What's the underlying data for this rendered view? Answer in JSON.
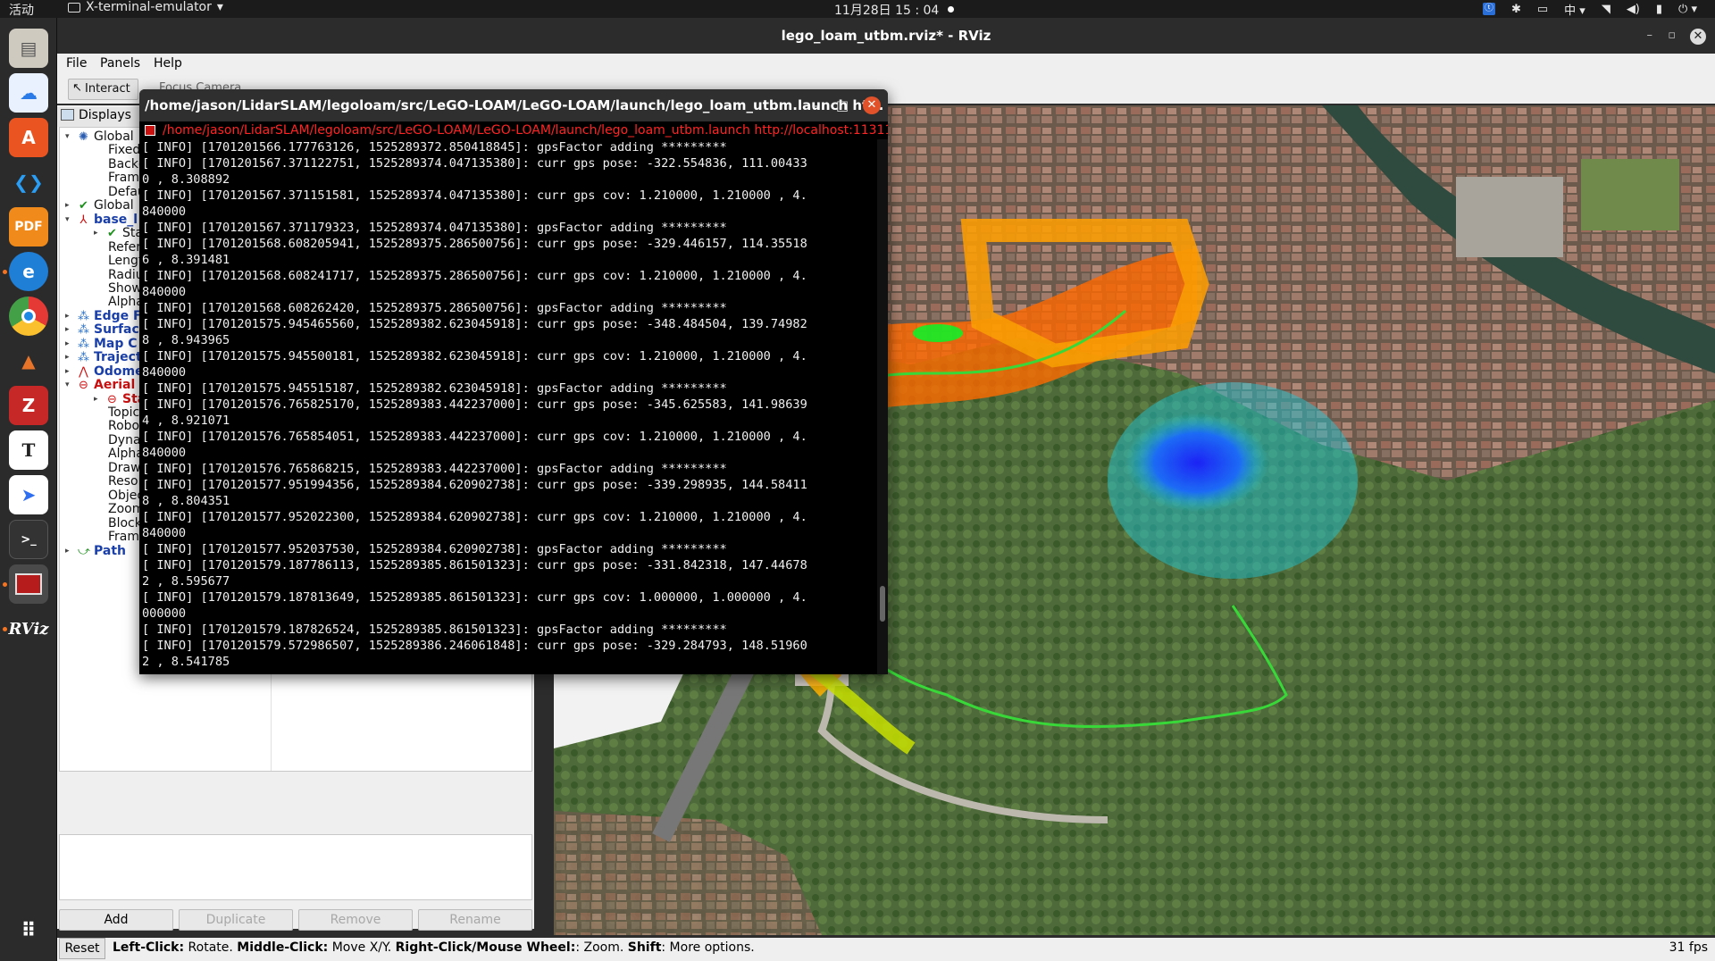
{
  "topbar": {
    "activities": "活动",
    "app_name": "X-terminal-emulator",
    "app_arrow": "▾",
    "clock": "11月28日  15 : 04",
    "tray_badge": "ⓣ",
    "input_method": "中 ▾",
    "icons": [
      "bluetooth-icon",
      "keyboard-icon",
      "network-icon",
      "volume-icon",
      "battery-icon",
      "power-icon"
    ]
  },
  "dock": {
    "items": [
      "files-icon",
      "baidunetdisk-icon",
      "app-store-icon",
      "vscode-icon",
      "pdf-editor-icon",
      "edge-icon",
      "chrome-icon",
      "matlab-icon",
      "zotero-icon",
      "typora-icon",
      "feishu-icon",
      "terminal-icon",
      "terminator-icon",
      "rviz-icon",
      "apps-grid-icon"
    ],
    "rviz_label": "RViz"
  },
  "rviz": {
    "title": "lego_loam_utbm.rviz* - RViz",
    "menu": [
      "File",
      "Panels",
      "Help"
    ],
    "toolbar": {
      "interact": "Interact",
      "focus_camera": "Focus Camera"
    },
    "displays_title": "Displays",
    "tree": [
      {
        "label": "Global",
        "icon": "gear-icon",
        "expand": "▾",
        "style": "normal"
      },
      {
        "label": "Fixed F",
        "icon": "",
        "expand": "",
        "style": "normal"
      },
      {
        "label": "Backgr",
        "icon": "",
        "expand": "",
        "style": "normal"
      },
      {
        "label": "Frame",
        "icon": "",
        "expand": "",
        "style": "normal"
      },
      {
        "label": "Defaul",
        "icon": "",
        "expand": "",
        "style": "normal"
      },
      {
        "label": "Global",
        "icon": "check-icon",
        "expand": "▸",
        "style": "normal"
      },
      {
        "label": "base_l",
        "icon": "axes-icon",
        "expand": "▾",
        "style": "blue"
      },
      {
        "label": "Stat",
        "icon": "check-icon",
        "expand": "▸",
        "style": "normal"
      },
      {
        "label": "Refere",
        "icon": "",
        "expand": "",
        "style": "normal"
      },
      {
        "label": "Length",
        "icon": "",
        "expand": "",
        "style": "normal"
      },
      {
        "label": "Radius",
        "icon": "",
        "expand": "",
        "style": "normal"
      },
      {
        "label": "Show T",
        "icon": "",
        "expand": "",
        "style": "normal"
      },
      {
        "label": "Alpha",
        "icon": "",
        "expand": "",
        "style": "normal"
      },
      {
        "label": "Edge F",
        "icon": "pointcloud-icon",
        "expand": "▸",
        "style": "blue"
      },
      {
        "label": "Surfac",
        "icon": "pointcloud-icon",
        "expand": "▸",
        "style": "blue"
      },
      {
        "label": "Map C",
        "icon": "pointcloud-icon",
        "expand": "▸",
        "style": "blue"
      },
      {
        "label": "Traject",
        "icon": "pointcloud-icon",
        "expand": "▸",
        "style": "blue"
      },
      {
        "label": "Odome",
        "icon": "odometry-icon",
        "expand": "▸",
        "style": "blue"
      },
      {
        "label": "Aerial",
        "icon": "error-icon",
        "expand": "▾",
        "style": "red"
      },
      {
        "label": "Stat",
        "icon": "error-icon",
        "expand": "▸",
        "style": "red"
      },
      {
        "label": "Topic",
        "icon": "",
        "expand": "",
        "style": "normal"
      },
      {
        "label": "Robot",
        "icon": "",
        "expand": "",
        "style": "normal"
      },
      {
        "label": "Dynam",
        "icon": "",
        "expand": "",
        "style": "normal"
      },
      {
        "label": "Alpha",
        "icon": "",
        "expand": "",
        "style": "normal"
      },
      {
        "label": "Draw B",
        "icon": "",
        "expand": "",
        "style": "normal"
      },
      {
        "label": "Resolu",
        "icon": "",
        "expand": "",
        "style": "normal"
      },
      {
        "label": "Object",
        "icon": "",
        "expand": "",
        "style": "normal"
      },
      {
        "label": "Zoom",
        "icon": "",
        "expand": "",
        "style": "normal"
      },
      {
        "label": "Blocks",
        "icon": "",
        "expand": "",
        "style": "normal"
      },
      {
        "label": "Frame",
        "icon": "",
        "expand": "",
        "style": "normal"
      },
      {
        "label": "Path",
        "icon": "path-icon",
        "expand": "▸",
        "style": "blue"
      }
    ],
    "buttons": {
      "add": "Add",
      "duplicate": "Duplicate",
      "remove": "Remove",
      "rename": "Rename"
    },
    "status": {
      "reset": "Reset",
      "hint_parts": [
        {
          "text": "Left-Click:",
          "bold": true
        },
        {
          "text": " Rotate. ",
          "bold": false
        },
        {
          "text": "Middle-Click:",
          "bold": true
        },
        {
          "text": " Move X/Y. ",
          "bold": false
        },
        {
          "text": "Right-Click/Mouse Wheel:",
          "bold": true
        },
        {
          "text": ": Zoom. ",
          "bold": false
        },
        {
          "text": "Shift",
          "bold": true
        },
        {
          "text": ": More options.",
          "bold": false
        }
      ],
      "fps": "31 fps"
    }
  },
  "terminal": {
    "title": "/home/jason/LidarSLAM/legoloam/src/LeGO-LOAM/LeGO-LOAM/launch/lego_loam_utbm.launch ht...",
    "tab_title": "/home/jason/LidarSLAM/legoloam/src/LeGO-LOAM/LeGO-LOAM/launch/lego_loam_utbm.launch http://localhost:11311",
    "minimize": "–",
    "maximize": "□",
    "close": "✕",
    "lines": [
      "[ INFO] [1701201566.177763126, 1525289372.850418845]: gpsFactor adding *********",
      "[ INFO] [1701201567.371122751, 1525289374.047135380]: curr gps pose: -322.554836, 111.00433",
      "0 , 8.308892",
      "[ INFO] [1701201567.371151581, 1525289374.047135380]: curr gps cov: 1.210000, 1.210000 , 4.",
      "840000",
      "[ INFO] [1701201567.371179323, 1525289374.047135380]: gpsFactor adding *********",
      "[ INFO] [1701201568.608205941, 1525289375.286500756]: curr gps pose: -329.446157, 114.35518",
      "6 , 8.391481",
      "[ INFO] [1701201568.608241717, 1525289375.286500756]: curr gps cov: 1.210000, 1.210000 , 4.",
      "840000",
      "[ INFO] [1701201568.608262420, 1525289375.286500756]: gpsFactor adding *********",
      "[ INFO] [1701201575.945465560, 1525289382.623045918]: curr gps pose: -348.484504, 139.74982",
      "8 , 8.943965",
      "[ INFO] [1701201575.945500181, 1525289382.623045918]: curr gps cov: 1.210000, 1.210000 , 4.",
      "840000",
      "[ INFO] [1701201575.945515187, 1525289382.623045918]: gpsFactor adding *********",
      "[ INFO] [1701201576.765825170, 1525289383.442237000]: curr gps pose: -345.625583, 141.98639",
      "4 , 8.921071",
      "[ INFO] [1701201576.765854051, 1525289383.442237000]: curr gps cov: 1.210000, 1.210000 , 4.",
      "840000",
      "[ INFO] [1701201576.765868215, 1525289383.442237000]: gpsFactor adding *********",
      "[ INFO] [1701201577.951994356, 1525289384.620902738]: curr gps pose: -339.298935, 144.58411",
      "8 , 8.804351",
      "[ INFO] [1701201577.952022300, 1525289384.620902738]: curr gps cov: 1.210000, 1.210000 , 4.",
      "840000",
      "[ INFO] [1701201577.952037530, 1525289384.620902738]: gpsFactor adding *********",
      "[ INFO] [1701201579.187786113, 1525289385.861501323]: curr gps pose: -331.842318, 147.44678",
      "2 , 8.595677",
      "[ INFO] [1701201579.187813649, 1525289385.861501323]: curr gps cov: 1.000000, 1.000000 , 4.",
      "000000",
      "[ INFO] [1701201579.187826524, 1525289385.861501323]: gpsFactor adding *********",
      "[ INFO] [1701201579.572986507, 1525289386.246061848]: curr gps pose: -329.284793, 148.51960",
      "2 , 8.541785"
    ]
  },
  "map_view": {
    "colors": {
      "aerial_green": "#4e6a3a",
      "roof": "#9a6a5a",
      "road": "#bdb8ae",
      "river": "#2f4a3e",
      "path_line": "#39d839",
      "cloud_orange": "#ff7a00",
      "cloud_yellow": "#e8e000",
      "cloud_blue": "#1a3cff",
      "cloud_cyan": "#1ec8d8"
    }
  }
}
